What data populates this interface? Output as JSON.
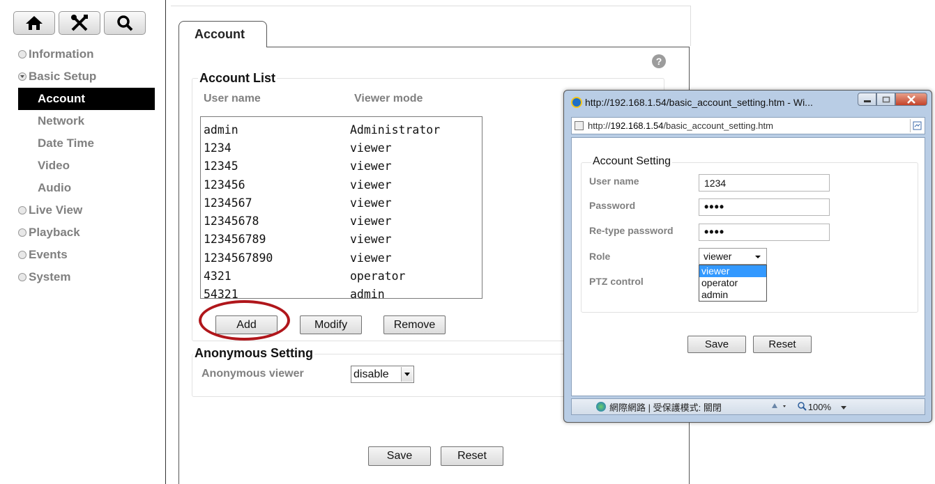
{
  "nav": {
    "icons": [
      "home-icon",
      "tools-icon",
      "search-icon"
    ],
    "items": [
      {
        "label": "Information"
      },
      {
        "label": "Basic Setup"
      },
      {
        "label": "Live View"
      },
      {
        "label": "Playback"
      },
      {
        "label": "Events"
      },
      {
        "label": "System"
      }
    ],
    "sub_items": [
      {
        "label": "Account"
      },
      {
        "label": "Network"
      },
      {
        "label": "Date Time"
      },
      {
        "label": "Video"
      },
      {
        "label": "Audio"
      }
    ]
  },
  "main": {
    "tab": "Account",
    "help": "?",
    "account_list": {
      "title": "Account List",
      "col_user": "User name",
      "col_mode": "Viewer mode",
      "rows": [
        {
          "user": "admin",
          "mode": "Administrator"
        },
        {
          "user": "1234",
          "mode": "viewer"
        },
        {
          "user": "12345",
          "mode": "viewer"
        },
        {
          "user": "123456",
          "mode": "viewer"
        },
        {
          "user": "1234567",
          "mode": "viewer"
        },
        {
          "user": "12345678",
          "mode": "viewer"
        },
        {
          "user": "123456789",
          "mode": "viewer"
        },
        {
          "user": "1234567890",
          "mode": "viewer"
        },
        {
          "user": "4321",
          "mode": "operator"
        },
        {
          "user": "54321",
          "mode": "admin"
        }
      ],
      "add": "Add",
      "modify": "Modify",
      "remove": "Remove"
    },
    "anonymous": {
      "title": "Anonymous Setting",
      "label": "Anonymous viewer",
      "value": "disable"
    },
    "save": "Save",
    "reset": "Reset"
  },
  "popup": {
    "title": "http://192.168.1.54/basic_account_setting.htm - Wi...",
    "address_prefix": "http://",
    "address_host": "192.168.1.54",
    "address_path": "/basic_account_setting.htm",
    "group_title": "Account Setting",
    "user_label": "User name",
    "user_value": "1234",
    "password_label": "Password",
    "password_value": "••••",
    "retype_label": "Re-type password",
    "retype_value": "••••",
    "role_label": "Role",
    "role_value": "viewer",
    "role_options": [
      "viewer",
      "operator",
      "admin"
    ],
    "ptz_label": "PTZ control",
    "save": "Save",
    "reset": "Reset",
    "status_text": "網際網路 | 受保護模式: 關閉",
    "zoom": "100%"
  }
}
